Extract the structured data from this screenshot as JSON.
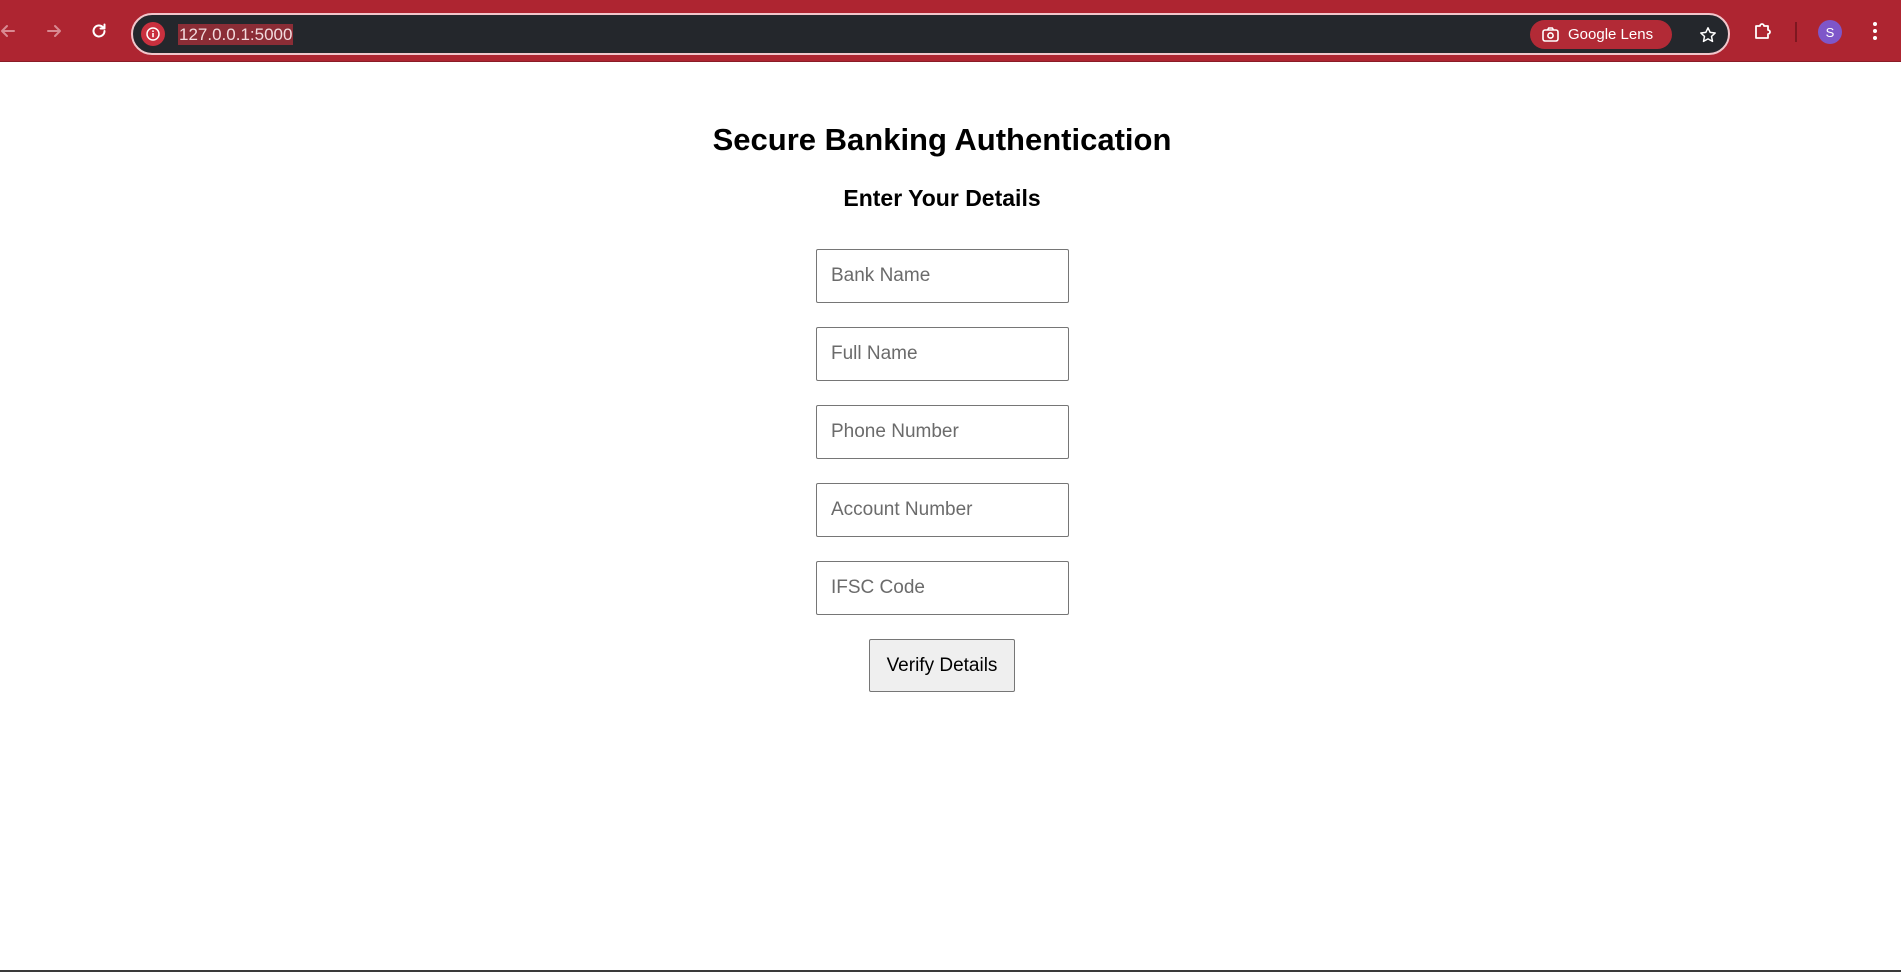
{
  "browser": {
    "url": "127.0.0.1:5000",
    "lens_label": "Google Lens",
    "profile_initial": "S",
    "theme_color": "#ae2531",
    "icons": {
      "back": "arrow-left-icon",
      "forward": "arrow-right-icon",
      "reload": "reload-icon",
      "site_info": "info-icon",
      "lens": "camera-search-icon",
      "bookmark": "star-icon",
      "extensions": "puzzle-icon",
      "menu": "kebab-menu-icon"
    }
  },
  "page": {
    "title": "Secure Banking Authentication",
    "subtitle": "Enter Your Details",
    "form": {
      "bank_name_placeholder": "Bank Name",
      "full_name_placeholder": "Full Name",
      "phone_placeholder": "Phone Number",
      "account_placeholder": "Account Number",
      "ifsc_placeholder": "IFSC Code",
      "submit_label": "Verify Details"
    }
  }
}
